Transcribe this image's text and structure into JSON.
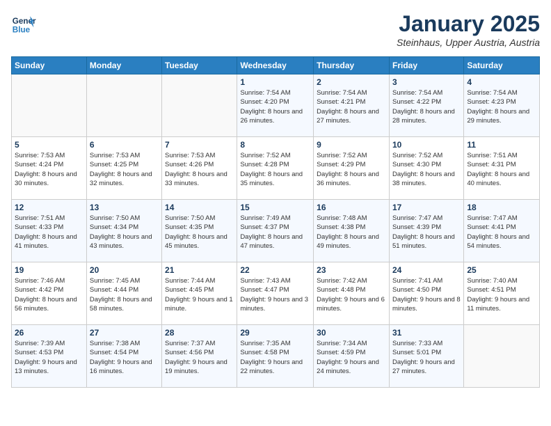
{
  "header": {
    "logo_line1": "General",
    "logo_line2": "Blue",
    "month_title": "January 2025",
    "location": "Steinhaus, Upper Austria, Austria"
  },
  "weekdays": [
    "Sunday",
    "Monday",
    "Tuesday",
    "Wednesday",
    "Thursday",
    "Friday",
    "Saturday"
  ],
  "weeks": [
    [
      {
        "day": "",
        "info": ""
      },
      {
        "day": "",
        "info": ""
      },
      {
        "day": "",
        "info": ""
      },
      {
        "day": "1",
        "info": "Sunrise: 7:54 AM\nSunset: 4:20 PM\nDaylight: 8 hours and 26 minutes."
      },
      {
        "day": "2",
        "info": "Sunrise: 7:54 AM\nSunset: 4:21 PM\nDaylight: 8 hours and 27 minutes."
      },
      {
        "day": "3",
        "info": "Sunrise: 7:54 AM\nSunset: 4:22 PM\nDaylight: 8 hours and 28 minutes."
      },
      {
        "day": "4",
        "info": "Sunrise: 7:54 AM\nSunset: 4:23 PM\nDaylight: 8 hours and 29 minutes."
      }
    ],
    [
      {
        "day": "5",
        "info": "Sunrise: 7:53 AM\nSunset: 4:24 PM\nDaylight: 8 hours and 30 minutes."
      },
      {
        "day": "6",
        "info": "Sunrise: 7:53 AM\nSunset: 4:25 PM\nDaylight: 8 hours and 32 minutes."
      },
      {
        "day": "7",
        "info": "Sunrise: 7:53 AM\nSunset: 4:26 PM\nDaylight: 8 hours and 33 minutes."
      },
      {
        "day": "8",
        "info": "Sunrise: 7:52 AM\nSunset: 4:28 PM\nDaylight: 8 hours and 35 minutes."
      },
      {
        "day": "9",
        "info": "Sunrise: 7:52 AM\nSunset: 4:29 PM\nDaylight: 8 hours and 36 minutes."
      },
      {
        "day": "10",
        "info": "Sunrise: 7:52 AM\nSunset: 4:30 PM\nDaylight: 8 hours and 38 minutes."
      },
      {
        "day": "11",
        "info": "Sunrise: 7:51 AM\nSunset: 4:31 PM\nDaylight: 8 hours and 40 minutes."
      }
    ],
    [
      {
        "day": "12",
        "info": "Sunrise: 7:51 AM\nSunset: 4:33 PM\nDaylight: 8 hours and 41 minutes."
      },
      {
        "day": "13",
        "info": "Sunrise: 7:50 AM\nSunset: 4:34 PM\nDaylight: 8 hours and 43 minutes."
      },
      {
        "day": "14",
        "info": "Sunrise: 7:50 AM\nSunset: 4:35 PM\nDaylight: 8 hours and 45 minutes."
      },
      {
        "day": "15",
        "info": "Sunrise: 7:49 AM\nSunset: 4:37 PM\nDaylight: 8 hours and 47 minutes."
      },
      {
        "day": "16",
        "info": "Sunrise: 7:48 AM\nSunset: 4:38 PM\nDaylight: 8 hours and 49 minutes."
      },
      {
        "day": "17",
        "info": "Sunrise: 7:47 AM\nSunset: 4:39 PM\nDaylight: 8 hours and 51 minutes."
      },
      {
        "day": "18",
        "info": "Sunrise: 7:47 AM\nSunset: 4:41 PM\nDaylight: 8 hours and 54 minutes."
      }
    ],
    [
      {
        "day": "19",
        "info": "Sunrise: 7:46 AM\nSunset: 4:42 PM\nDaylight: 8 hours and 56 minutes."
      },
      {
        "day": "20",
        "info": "Sunrise: 7:45 AM\nSunset: 4:44 PM\nDaylight: 8 hours and 58 minutes."
      },
      {
        "day": "21",
        "info": "Sunrise: 7:44 AM\nSunset: 4:45 PM\nDaylight: 9 hours and 1 minute."
      },
      {
        "day": "22",
        "info": "Sunrise: 7:43 AM\nSunset: 4:47 PM\nDaylight: 9 hours and 3 minutes."
      },
      {
        "day": "23",
        "info": "Sunrise: 7:42 AM\nSunset: 4:48 PM\nDaylight: 9 hours and 6 minutes."
      },
      {
        "day": "24",
        "info": "Sunrise: 7:41 AM\nSunset: 4:50 PM\nDaylight: 9 hours and 8 minutes."
      },
      {
        "day": "25",
        "info": "Sunrise: 7:40 AM\nSunset: 4:51 PM\nDaylight: 9 hours and 11 minutes."
      }
    ],
    [
      {
        "day": "26",
        "info": "Sunrise: 7:39 AM\nSunset: 4:53 PM\nDaylight: 9 hours and 13 minutes."
      },
      {
        "day": "27",
        "info": "Sunrise: 7:38 AM\nSunset: 4:54 PM\nDaylight: 9 hours and 16 minutes."
      },
      {
        "day": "28",
        "info": "Sunrise: 7:37 AM\nSunset: 4:56 PM\nDaylight: 9 hours and 19 minutes."
      },
      {
        "day": "29",
        "info": "Sunrise: 7:35 AM\nSunset: 4:58 PM\nDaylight: 9 hours and 22 minutes."
      },
      {
        "day": "30",
        "info": "Sunrise: 7:34 AM\nSunset: 4:59 PM\nDaylight: 9 hours and 24 minutes."
      },
      {
        "day": "31",
        "info": "Sunrise: 7:33 AM\nSunset: 5:01 PM\nDaylight: 9 hours and 27 minutes."
      },
      {
        "day": "",
        "info": ""
      }
    ]
  ]
}
